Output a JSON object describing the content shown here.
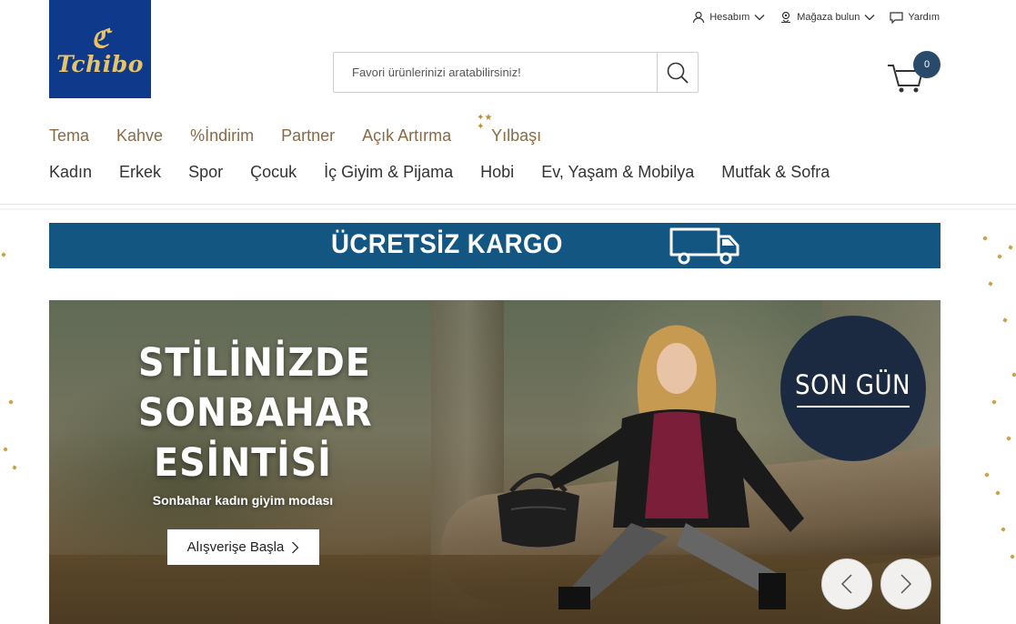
{
  "brand": {
    "logo_text": "Tchibo",
    "primary": "#0f3a8c",
    "gold": "#e7c36a"
  },
  "top_links": [
    {
      "label": "Hesabım",
      "icon": "user-icon",
      "dropdown": true
    },
    {
      "label": "Mağaza bulun",
      "icon": "location-icon",
      "dropdown": true
    },
    {
      "label": "Yardım",
      "icon": "chat-icon",
      "dropdown": false
    }
  ],
  "search": {
    "placeholder": "Favori ürünlerinizi aratabilirsiniz!",
    "value": ""
  },
  "cart": {
    "count": "0"
  },
  "nav_primary": [
    "Tema",
    "Kahve",
    "%İndirim",
    "Partner",
    "Açık Artırma",
    "Yılbaşı"
  ],
  "nav_secondary": [
    "Kadın",
    "Erkek",
    "Spor",
    "Çocuk",
    "İç Giyim & Pijama",
    "Hobi",
    "Ev, Yaşam & Mobilya",
    "Mutfak & Sofra"
  ],
  "shipping_banner": {
    "text": "ÜCRETSİZ KARGO",
    "color": "#135682"
  },
  "hero": {
    "headline_lines": [
      "STİLİNİZDE",
      "SONBAHAR",
      "ESİNTİSİ"
    ],
    "subtitle": "Sonbahar kadın giyim modası",
    "cta_label": "Alışverişe Başla",
    "badge": "SON GÜN"
  }
}
